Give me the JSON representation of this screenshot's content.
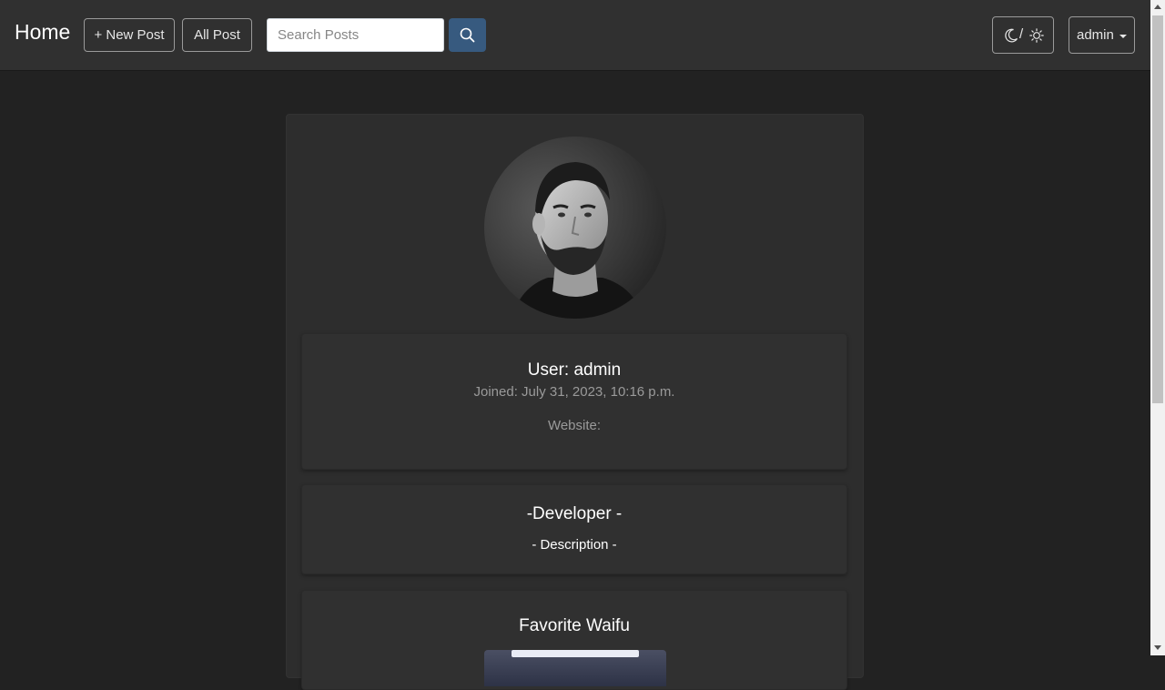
{
  "navbar": {
    "brand": "Home",
    "new_post_label": "+ New Post",
    "all_post_label": "All Post",
    "search_placeholder": "Search Posts",
    "search_value": "",
    "theme_toggle_separator": "/",
    "user_menu_label": "admin"
  },
  "icons": {
    "search": "search-icon",
    "moon": "moon-icon",
    "sun": "sun-icon",
    "caret": "caret-down-icon"
  },
  "profile": {
    "user_title": "User: admin",
    "joined": "Joined: July 31, 2023, 10:16 p.m.",
    "website": "Website:"
  },
  "developer": {
    "title": "-Developer -",
    "description": "- Description -"
  },
  "waifu": {
    "title": "Favorite Waifu"
  },
  "colors": {
    "background": "#222222",
    "navbar": "#303030",
    "card": "#2d2d2d",
    "inner_card": "#303030",
    "primary": "#375a7f",
    "muted_text": "#9a9a9a"
  }
}
